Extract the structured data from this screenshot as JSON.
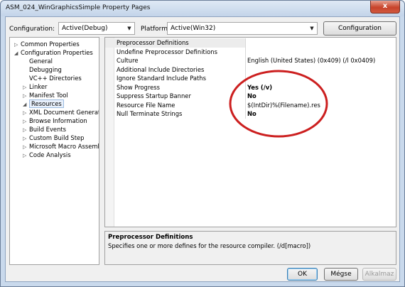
{
  "window": {
    "title": "ASM_024_WinGraphicsSimple Property Pages",
    "close_glyph": "x"
  },
  "toolbar": {
    "configuration_label": "Configuration:",
    "configuration_value": "Active(Debug)",
    "platform_label": "Platform:",
    "platform_value": "Active(Win32)",
    "config_manager_label": "Configuration Manager..."
  },
  "tree": {
    "items": [
      {
        "label": "Common Properties",
        "toggle": "▷"
      },
      {
        "label": "Configuration Properties",
        "toggle": "◢"
      },
      {
        "label": "General",
        "toggle": ""
      },
      {
        "label": "Debugging",
        "toggle": ""
      },
      {
        "label": "VC++ Directories",
        "toggle": ""
      },
      {
        "label": "Linker",
        "toggle": "▷"
      },
      {
        "label": "Manifest Tool",
        "toggle": "▷"
      },
      {
        "label": "Resources",
        "toggle": "◢"
      },
      {
        "label": "XML Document Generator",
        "toggle": "▷"
      },
      {
        "label": "Browse Information",
        "toggle": "▷"
      },
      {
        "label": "Build Events",
        "toggle": "▷"
      },
      {
        "label": "Custom Build Step",
        "toggle": "▷"
      },
      {
        "label": "Microsoft Macro Assembler",
        "toggle": "▷"
      },
      {
        "label": "Code Analysis",
        "toggle": "▷"
      }
    ]
  },
  "grid": {
    "rows": [
      {
        "name": "Preprocessor Definitions",
        "value": ""
      },
      {
        "name": "Undefine Preprocessor Definitions",
        "value": ""
      },
      {
        "name": "Culture",
        "value": "English (United States) (0x409) (/l 0x0409)"
      },
      {
        "name": "Additional Include Directories",
        "value": ""
      },
      {
        "name": "Ignore Standard Include Paths",
        "value": ""
      },
      {
        "name": "Show Progress",
        "value": "Yes (/v)"
      },
      {
        "name": "Suppress Startup Banner",
        "value": "No"
      },
      {
        "name": "Resource File Name",
        "value": "$(IntDir)%(Filename).res"
      },
      {
        "name": "Null Terminate Strings",
        "value": "No"
      }
    ]
  },
  "description": {
    "title": "Preprocessor Definitions",
    "text": "Specifies one or more defines for the resource compiler. (/d[macro])"
  },
  "buttons": {
    "ok": "OK",
    "cancel": "Mégse",
    "apply": "Alkalmaz"
  },
  "colors": {
    "annotation_ellipse": "#cc1f1f",
    "close_button": "#c7432b",
    "selection": "#e8f0fb"
  }
}
